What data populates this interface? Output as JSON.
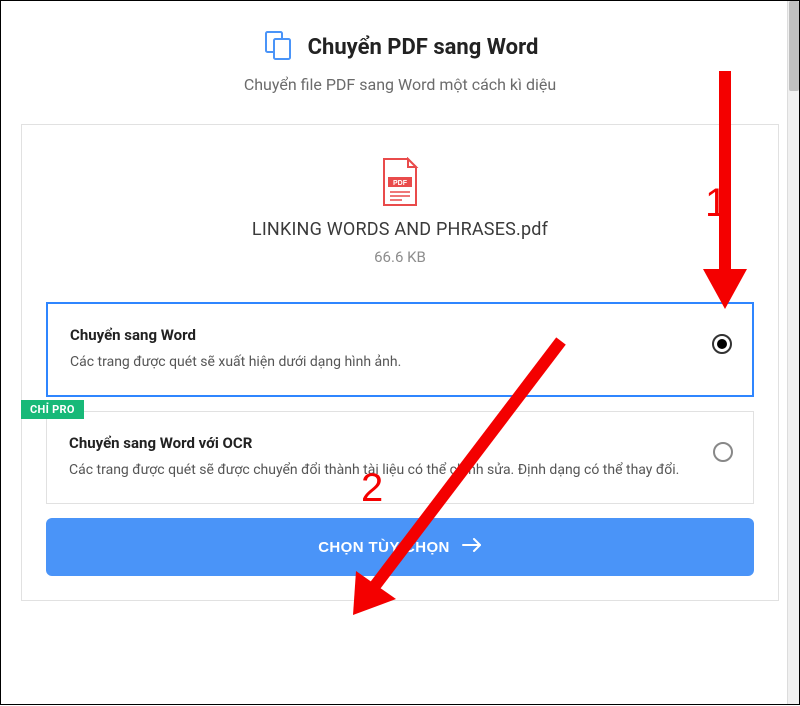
{
  "header": {
    "title": "Chuyển PDF sang Word",
    "subtitle": "Chuyển file PDF sang Word một cách kì diệu"
  },
  "file": {
    "name": "LINKING WORDS AND PHRASES.pdf",
    "size": "66.6 KB",
    "icon_label": "PDF"
  },
  "options": [
    {
      "title": "Chuyển sang Word",
      "desc": "Các trang được quét sẽ xuất hiện dưới dạng hình ảnh.",
      "selected": true
    },
    {
      "title": "Chuyển sang Word với OCR",
      "desc": "Các trang được quét sẽ được chuyển đổi thành tài liệu có thể chỉnh sửa. Định dạng có thể thay đổi.",
      "selected": false,
      "pro_badge": "CHỈ PRO"
    }
  ],
  "button": {
    "label": "CHỌN TÙY CHỌN"
  },
  "annotations": {
    "num1": "1",
    "num2": "2"
  },
  "colors": {
    "accent": "#4a94f8",
    "pro": "#17b978",
    "annotation": "#f40000",
    "pdf_red": "#e94b4b"
  }
}
